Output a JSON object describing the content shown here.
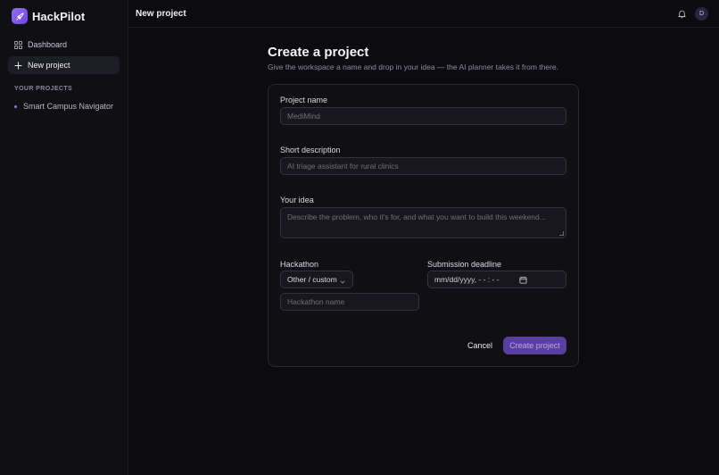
{
  "app": {
    "name": "HackPilot",
    "accent": "#8b5cf6"
  },
  "sidebar": {
    "items": [
      {
        "label": "Dashboard",
        "icon": "grid-icon"
      },
      {
        "label": "New project",
        "icon": "plus-icon",
        "active": true
      }
    ],
    "section_label": "YOUR PROJECTS",
    "projects": [
      {
        "label": "Smart Campus Navigator"
      }
    ]
  },
  "header": {
    "title": "New project",
    "avatar_initial": "D"
  },
  "main": {
    "heading": "Create a project",
    "subheading": "Give the workspace a name and drop in your idea — the AI planner takes it from there."
  },
  "form": {
    "project_name": {
      "label": "Project name",
      "placeholder": "MediMind"
    },
    "short_description": {
      "label": "Short description",
      "placeholder": "AI triage assistant for rural clinics"
    },
    "idea": {
      "label": "Your idea",
      "placeholder": "Describe the problem, who it's for, and what you want to build this weekend..."
    },
    "hackathon": {
      "label": "Hackathon",
      "selected": "Other / custom",
      "name_placeholder": "Hackathon name"
    },
    "deadline": {
      "label": "Submission deadline",
      "value": "mm/dd/yyyy, - - : - -"
    },
    "cancel_label": "Cancel",
    "create_label": "Create project"
  }
}
